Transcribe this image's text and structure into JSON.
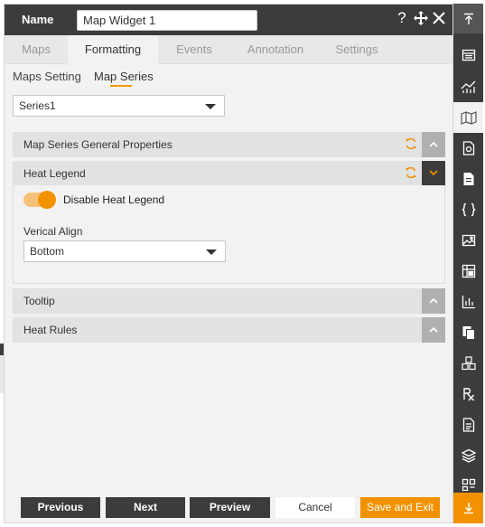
{
  "header": {
    "name_label": "Name",
    "name_value": "Map Widget 1",
    "help_icon": "question-icon",
    "move_icon": "move-icon",
    "close_icon": "close-icon"
  },
  "tabs": [
    {
      "label": "Maps"
    },
    {
      "label": "Formatting",
      "active": true
    },
    {
      "label": "Events"
    },
    {
      "label": "Annotation"
    },
    {
      "label": "Settings"
    }
  ],
  "subtabs": [
    {
      "label": "Maps Setting"
    },
    {
      "label": "Map Series",
      "active": true
    }
  ],
  "series_select": {
    "value": "Series1"
  },
  "sections": {
    "general": {
      "title": "Map Series General Properties",
      "expanded": false
    },
    "heat_legend": {
      "title": "Heat Legend",
      "expanded": true,
      "toggle_label": "Disable Heat Legend",
      "toggle_on": true,
      "align_label": "Verical Align",
      "align_value": "Bottom"
    },
    "tooltip": {
      "title": "Tooltip",
      "expanded": false
    },
    "heat_rules": {
      "title": "Heat Rules",
      "expanded": false
    }
  },
  "footer": {
    "previous": "Previous",
    "next": "Next",
    "preview": "Preview",
    "cancel": "Cancel",
    "save_exit": "Save and Exit"
  },
  "rail_icons": [
    "scroll-top-icon",
    "table-icon",
    "line-chart-icon",
    "map-icon",
    "file-settings-icon",
    "document-icon",
    "braces-icon",
    "image-icon",
    "grid-table-icon",
    "bar-chart-icon",
    "copy-icon",
    "cubes-icon",
    "rx-icon",
    "report-icon",
    "layers-icon",
    "qr-code-icon",
    "scroll-bottom-icon"
  ],
  "colors": {
    "dark": "#3c3c3c",
    "accent": "#f39200",
    "panel": "#f2f2f2",
    "section_header": "#e2e2e2"
  }
}
